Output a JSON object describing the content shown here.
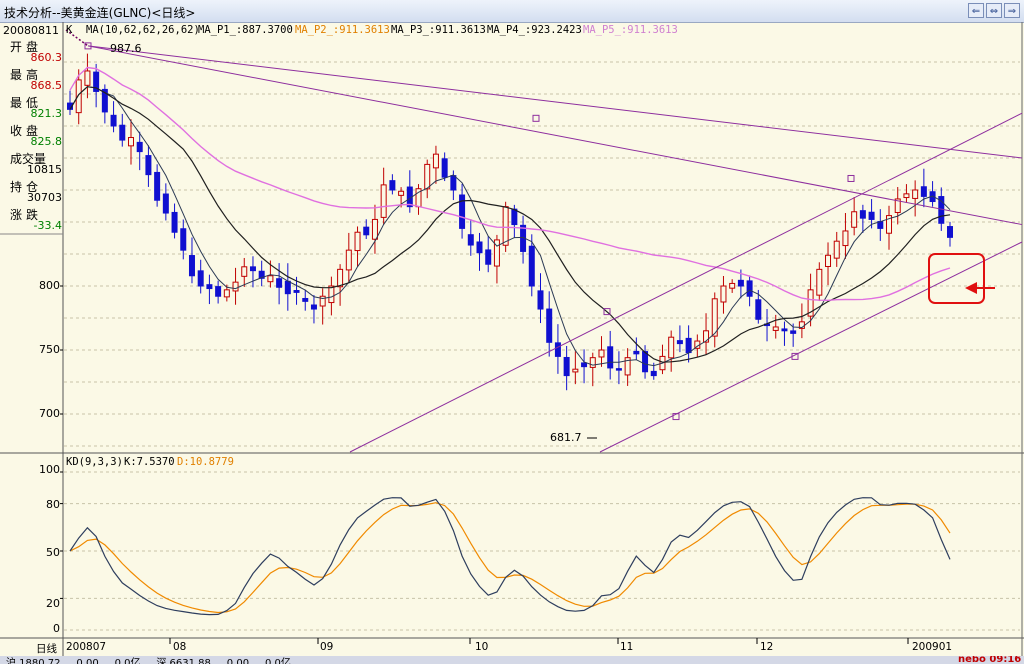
{
  "window": {
    "title": "技术分析--美黄金连(GLNC)<日线>",
    "buttons": [
      "⇐",
      "⇔",
      "⇒"
    ]
  },
  "info": {
    "date": "20080811",
    "rows": [
      {
        "label": "开盘",
        "value": "860.3",
        "color": "#C00000"
      },
      {
        "label": "最高",
        "value": "868.5",
        "color": "#C00000"
      },
      {
        "label": "最低",
        "value": "821.3",
        "color": "#008000"
      },
      {
        "label": "收盘",
        "value": "825.8",
        "color": "#008000"
      },
      {
        "label": "成交量",
        "value": "10815",
        "color": "#000000"
      },
      {
        "label": "持仓",
        "value": "30703",
        "color": "#000000"
      },
      {
        "label": "涨跌",
        "value": "-33.4",
        "color": "#008000"
      }
    ]
  },
  "main_header": {
    "k": "K",
    "ma": "MA(10,62,62,26,62)",
    "p1": "MA_P1_:887.3700",
    "p2": "MA_P2_:911.3613",
    "p3": "MA_P3_:911.3613",
    "p4": "MA_P4_:923.2423",
    "p5": "MA_P5_:911.3613"
  },
  "kd_header": {
    "name": "KD(9,3,3)",
    "k": "K:7.5370",
    "d": "D:10.8779"
  },
  "price_axis": [
    "800",
    "750",
    "700"
  ],
  "kd_axis": [
    "100",
    "80",
    "50",
    "20",
    "0"
  ],
  "time_labels": [
    "日线",
    "200807",
    "08",
    "09",
    "10",
    "11",
    "12",
    "200901"
  ],
  "annotations": {
    "high": "987.6",
    "low": "681.7"
  },
  "status": {
    "text": "沪 1880.72 ... 0.00 ... 0.0亿 ... 深 6631.88 ... 0.00 ... 0.0亿",
    "brand": "nebo 09:16"
  },
  "colors": {
    "up": "#C00000",
    "down": "#1010D0",
    "ma_short": "#2B3A55",
    "ma_long": "#202020",
    "ma_pink": "#E070E0",
    "channel": "#8E2E9E",
    "kd_k": "#2E3E5E",
    "kd_d": "#F08A00",
    "marker": "#E01010"
  },
  "chart_data": {
    "type": "candlestick",
    "title": "美黄金连(GLNC) 日线",
    "x_period": "2008-07 to 2009-01",
    "ylim": [
      681.7,
      987.6
    ],
    "price_high": 987.6,
    "price_low": 681.7,
    "close_path": [
      938,
      961,
      968,
      952,
      936,
      925,
      914,
      916,
      905,
      887,
      867,
      857,
      842,
      828,
      808,
      800,
      798,
      792,
      797,
      803,
      815,
      812,
      806,
      808,
      799,
      794,
      795,
      788,
      782,
      792,
      800,
      813,
      828,
      842,
      840,
      852,
      879,
      875,
      874,
      862,
      876,
      895,
      903,
      885,
      875,
      845,
      832,
      826,
      817,
      836,
      862,
      848,
      827,
      800,
      782,
      756,
      745,
      730,
      735,
      737,
      744,
      750,
      736,
      735,
      744,
      747,
      733,
      730,
      745,
      760,
      755,
      748,
      757,
      765,
      790,
      800,
      802,
      800,
      792,
      774,
      770,
      768,
      765,
      763,
      772,
      797,
      813,
      824,
      835,
      843,
      858,
      853,
      852,
      845,
      855,
      868,
      872,
      875,
      870,
      866,
      849,
      838
    ]
  }
}
